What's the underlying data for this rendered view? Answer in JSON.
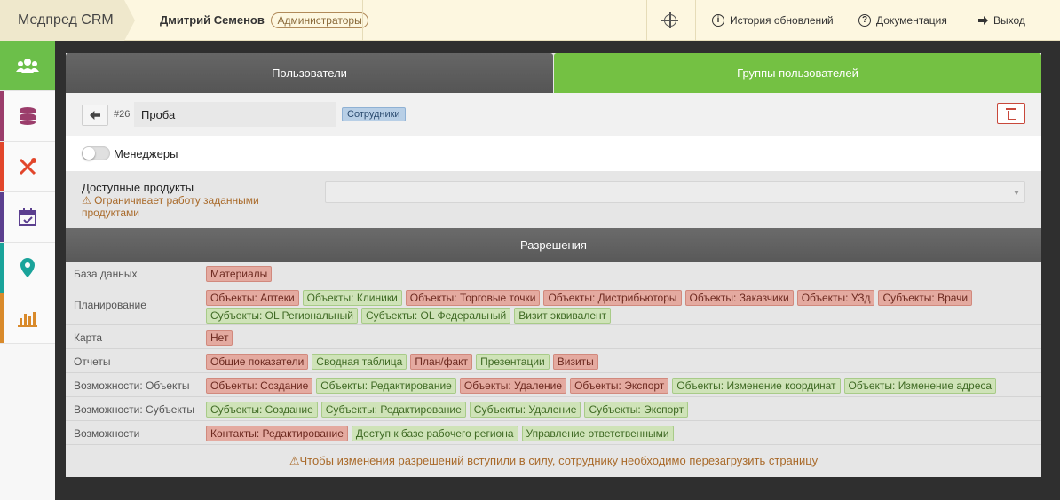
{
  "header": {
    "brand": "Медпред CRM",
    "user_name": "Дмитрий Семенов",
    "user_role": "Администраторы",
    "history_label": "История обновлений",
    "docs_label": "Документация",
    "exit_label": "Выход"
  },
  "sidebar": {
    "items": [
      {
        "icon": "users-icon",
        "color": "#6cbf4a",
        "active": true
      },
      {
        "icon": "database-icon",
        "color": "#9b3d6b"
      },
      {
        "icon": "tools-icon",
        "color": "#e2462b"
      },
      {
        "icon": "calendar-check-icon",
        "color": "#5b3f8f"
      },
      {
        "icon": "map-marker-icon",
        "color": "#1aa39a"
      },
      {
        "icon": "bar-chart-icon",
        "color": "#d98a2b"
      }
    ]
  },
  "tabs": {
    "users": "Пользователи",
    "groups": "Группы пользователей"
  },
  "group": {
    "id": "#26",
    "name": "Проба",
    "type_tag": "Сотрудники"
  },
  "managers": {
    "label": "Менеджеры",
    "enabled": false
  },
  "products": {
    "label": "Доступные продукты",
    "warning": "⚠ Ограничивает работу заданными продуктами",
    "selected": ""
  },
  "permissions": {
    "title": "Разрешения",
    "rows": [
      {
        "label": "База данных",
        "tags": [
          {
            "text": "Материалы",
            "state": "red"
          }
        ]
      },
      {
        "label": "Планирование",
        "tags": [
          {
            "text": "Объекты: Аптеки",
            "state": "red"
          },
          {
            "text": "Объекты: Клиники",
            "state": "green"
          },
          {
            "text": "Объекты: Торговые точки",
            "state": "red"
          },
          {
            "text": "Объекты: Дистрибьюторы",
            "state": "red"
          },
          {
            "text": "Объекты: Заказчики",
            "state": "red"
          },
          {
            "text": "Объекты: УЗд",
            "state": "red"
          },
          {
            "text": "Субъекты: Врачи",
            "state": "red"
          },
          {
            "text": "Субъекты: OL Региональный",
            "state": "green"
          },
          {
            "text": "Субъекты: OL Федеральный",
            "state": "green"
          },
          {
            "text": "Визит эквивалент",
            "state": "green"
          }
        ]
      },
      {
        "label": "Карта",
        "tags": [
          {
            "text": "Нет",
            "state": "red"
          }
        ]
      },
      {
        "label": "Отчеты",
        "tags": [
          {
            "text": "Общие показатели",
            "state": "red"
          },
          {
            "text": "Сводная таблица",
            "state": "green"
          },
          {
            "text": "План/факт",
            "state": "red"
          },
          {
            "text": "Презентации",
            "state": "green"
          },
          {
            "text": "Визиты",
            "state": "red"
          }
        ]
      },
      {
        "label": "Возможности: Объекты",
        "tags": [
          {
            "text": "Объекты: Создание",
            "state": "red"
          },
          {
            "text": "Объекты: Редактирование",
            "state": "green"
          },
          {
            "text": "Объекты: Удаление",
            "state": "red"
          },
          {
            "text": "Объекты: Экспорт",
            "state": "red"
          },
          {
            "text": "Объекты: Изменение координат",
            "state": "green"
          },
          {
            "text": "Объекты: Изменение адреса",
            "state": "green"
          }
        ]
      },
      {
        "label": "Возможности: Субъекты",
        "tags": [
          {
            "text": "Субъекты: Создание",
            "state": "green"
          },
          {
            "text": "Субъекты: Редактирование",
            "state": "green"
          },
          {
            "text": "Субъекты: Удаление",
            "state": "green"
          },
          {
            "text": "Субъекты: Экспорт",
            "state": "green"
          }
        ]
      },
      {
        "label": "Возможности",
        "tags": [
          {
            "text": "Контакты: Редактирование",
            "state": "red"
          },
          {
            "text": "Доступ к базе рабочего региона",
            "state": "green"
          },
          {
            "text": "Управление ответственными",
            "state": "green"
          }
        ]
      }
    ],
    "footer_note": "⚠Чтобы изменения разрешений вступили в силу, сотруднику необходимо перезагрузить страницу"
  }
}
